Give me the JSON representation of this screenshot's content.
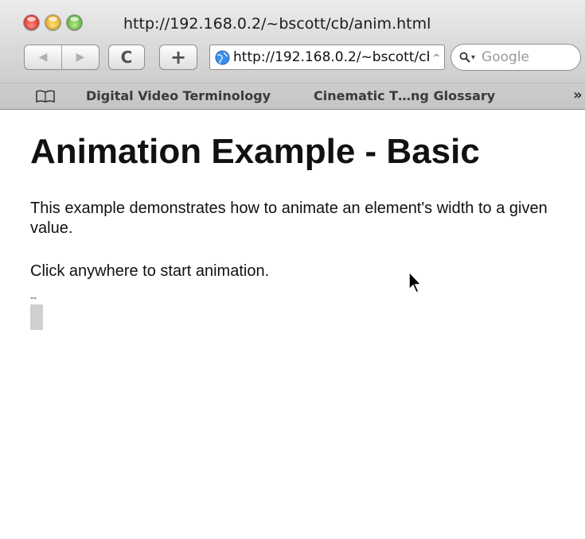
{
  "window": {
    "title": "http://192.168.0.2/~bscott/cb/anim.html"
  },
  "toolbar": {
    "back_icon": "◀",
    "forward_icon": "▶",
    "reload_icon": "C",
    "add_icon": "+",
    "url": "http://192.168.0.2/~bscott/cb/anim.html",
    "url_dropdown_icon": "^",
    "search_placeholder": "Google"
  },
  "bookmarks": {
    "items": [
      {
        "label": "Digital Video Terminology"
      },
      {
        "label": "Cinematic T…ng Glossary"
      }
    ],
    "overflow_icon": "»"
  },
  "page": {
    "title": "Animation Example - Basic",
    "description": "This example demonstrates how to animate an element's width to a given value.",
    "instruction": "Click anywhere to start animation.",
    "placeholder_text": "--"
  },
  "colors": {
    "animated_box": "#cfcfcf",
    "globe": "#3a8ee6"
  }
}
